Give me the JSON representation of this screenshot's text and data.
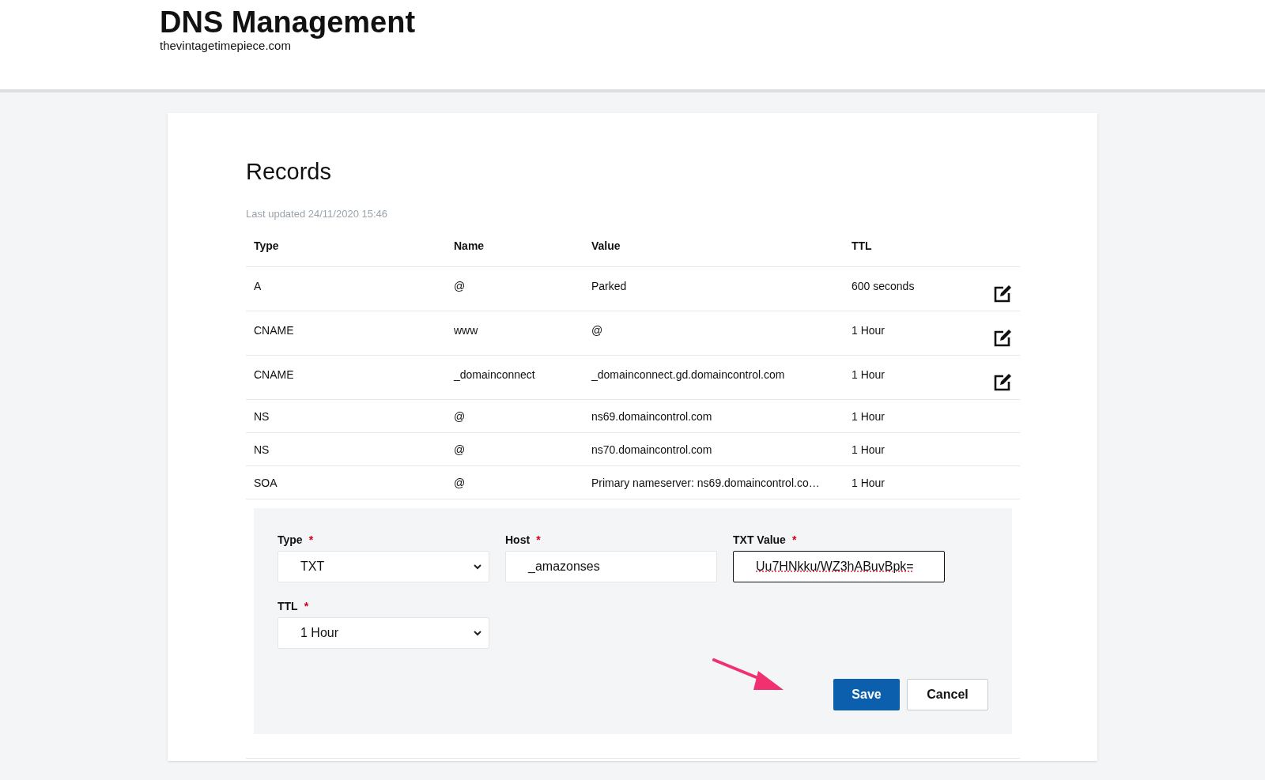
{
  "header": {
    "title": "DNS Management",
    "domain": "thevintagetimepiece.com"
  },
  "records": {
    "title": "Records",
    "last_updated": "Last updated 24/11/2020 15:46",
    "columns": [
      "Type",
      "Name",
      "Value",
      "TTL"
    ],
    "rows": [
      {
        "type": "A",
        "name": "@",
        "value": "Parked",
        "ttl": "600 seconds",
        "editable": true
      },
      {
        "type": "CNAME",
        "name": "www",
        "value": "@",
        "ttl": "1 Hour",
        "editable": true
      },
      {
        "type": "CNAME",
        "name": "_domainconnect",
        "value": "_domainconnect.gd.domaincontrol.com",
        "ttl": "1 Hour",
        "editable": true
      },
      {
        "type": "NS",
        "name": "@",
        "value": "ns69.domaincontrol.com",
        "ttl": "1 Hour",
        "editable": false
      },
      {
        "type": "NS",
        "name": "@",
        "value": "ns70.domaincontrol.com",
        "ttl": "1 Hour",
        "editable": false
      },
      {
        "type": "SOA",
        "name": "@",
        "value": "Primary nameserver: ns69.domaincontrol.co…",
        "ttl": "1 Hour",
        "editable": false
      }
    ]
  },
  "form": {
    "fields": [
      {
        "kind": "select",
        "label": "Type",
        "required_mark": "*",
        "value": "TXT",
        "focused": false
      },
      {
        "kind": "text",
        "label": "Host",
        "required_mark": "*",
        "value": "_amazonses",
        "focused": false
      },
      {
        "kind": "text",
        "label": "TXT Value",
        "required_mark": "*",
        "value": "Uu7HNkku/WZ3hABuvBpk=",
        "focused": true
      },
      {
        "kind": "select",
        "label": "TTL",
        "required_mark": "*",
        "value": "1 Hour",
        "focused": false
      }
    ],
    "buttons": [
      {
        "label": "Save",
        "kind": "primary"
      },
      {
        "label": "Cancel",
        "kind": "secondary"
      }
    ]
  }
}
